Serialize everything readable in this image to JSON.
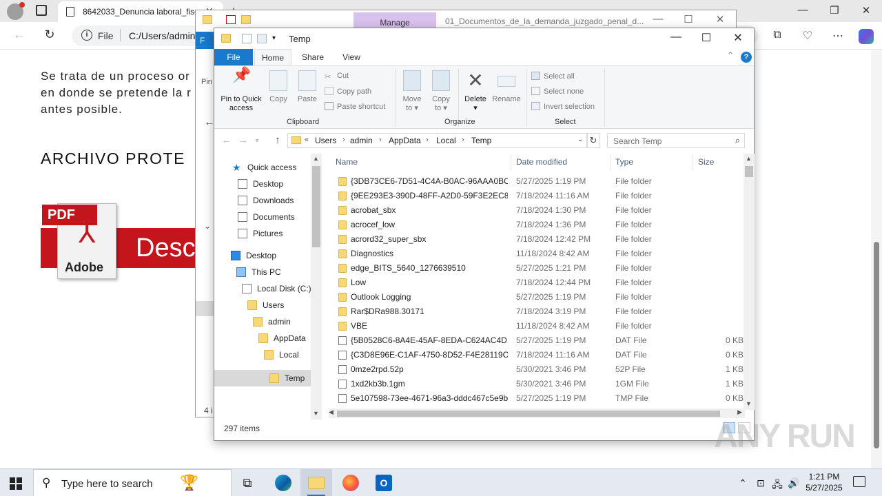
{
  "browser": {
    "tab_title": "8642033_Denuncia laboral_fiscal",
    "tab_close": "✕",
    "new_tab": "+",
    "address_scheme": "File",
    "address_url": "C:/Users/admin/",
    "win_min": "—",
    "win_max": "❐",
    "win_close": "✕"
  },
  "page": {
    "paragraph_lines": [
      "Se trata de un proceso or",
      "en donde se pretende la r",
      "antes posible."
    ],
    "heading": "ARCHIVO PROTE",
    "pdf_label": "PDF",
    "pdf_brand": "Adobe",
    "download_text": "Desc"
  },
  "back_window": {
    "manage_tab": "Manage",
    "title": "01_Documentos_de_la_demanda_juzgado_penal_d...",
    "menu_file": "F",
    "ribbon_label": "Pin",
    "status": "4 i"
  },
  "explorer": {
    "title": "Temp",
    "tabs": [
      "File",
      "Home",
      "Share",
      "View"
    ],
    "active_tab": "Home",
    "help": "?",
    "ribbon": {
      "clipboard": {
        "label": "Clipboard",
        "pin": [
          "Pin to Quick",
          "access"
        ],
        "copy": "Copy",
        "paste": "Paste",
        "cut": "Cut",
        "copy_path": "Copy path",
        "paste_shortcut": "Paste shortcut"
      },
      "organize": {
        "label": "Organize",
        "move_to": [
          "Move",
          "to ▾"
        ],
        "copy_to": [
          "Copy",
          "to ▾"
        ],
        "delete": [
          "Delete",
          "▾"
        ],
        "rename": "Rename"
      },
      "select": {
        "label": "Select",
        "select_all": "Select all",
        "select_none": "Select none",
        "invert": "Invert selection"
      }
    },
    "breadcrumb": [
      "Users",
      "admin",
      "AppData",
      "Local",
      "Temp"
    ],
    "breadcrumb_prefix": "«",
    "search_placeholder": "Search Temp",
    "nav_pane": [
      {
        "label": "Quick access",
        "icon": "star-icon"
      },
      {
        "label": "Desktop",
        "icon": "file-icon"
      },
      {
        "label": "Downloads",
        "icon": "file-icon"
      },
      {
        "label": "Documents",
        "icon": "file-icon"
      },
      {
        "label": "Pictures",
        "icon": "file-icon"
      },
      {
        "label": "Desktop",
        "icon": "desktop-icon"
      },
      {
        "label": "This PC",
        "icon": "pc-icon"
      },
      {
        "label": "Local Disk (C:)",
        "icon": "file-icon"
      },
      {
        "label": "Users",
        "icon": "folder-icon"
      },
      {
        "label": "admin",
        "icon": "folder-icon"
      },
      {
        "label": "AppData",
        "icon": "folder-icon"
      },
      {
        "label": "Local",
        "icon": "folder-icon"
      },
      {
        "label": "Temp",
        "icon": "folder-icon"
      }
    ],
    "columns": {
      "name": "Name",
      "date": "Date modified",
      "type": "Type",
      "size": "Size"
    },
    "files": [
      {
        "name": "{3DB73CE6-7D51-4C4A-B0AC-96AAA0BC...",
        "date": "5/27/2025 1:19 PM",
        "type": "File folder",
        "size": "",
        "icon": "folder-icon"
      },
      {
        "name": "{9EE293E3-390D-48FF-A2D0-59F3E2EC88...",
        "date": "7/18/2024 11:16 AM",
        "type": "File folder",
        "size": "",
        "icon": "folder-icon"
      },
      {
        "name": "acrobat_sbx",
        "date": "7/18/2024 1:30 PM",
        "type": "File folder",
        "size": "",
        "icon": "folder-icon"
      },
      {
        "name": "acrocef_low",
        "date": "7/18/2024 1:36 PM",
        "type": "File folder",
        "size": "",
        "icon": "folder-icon"
      },
      {
        "name": "acrord32_super_sbx",
        "date": "7/18/2024 12:42 PM",
        "type": "File folder",
        "size": "",
        "icon": "folder-icon"
      },
      {
        "name": "Diagnostics",
        "date": "11/18/2024 8:42 AM",
        "type": "File folder",
        "size": "",
        "icon": "folder-icon"
      },
      {
        "name": "edge_BITS_5640_1276639510",
        "date": "5/27/2025 1:21 PM",
        "type": "File folder",
        "size": "",
        "icon": "folder-icon"
      },
      {
        "name": "Low",
        "date": "7/18/2024 12:44 PM",
        "type": "File folder",
        "size": "",
        "icon": "folder-icon"
      },
      {
        "name": "Outlook Logging",
        "date": "5/27/2025 1:19 PM",
        "type": "File folder",
        "size": "",
        "icon": "folder-icon"
      },
      {
        "name": "Rar$DRa988.30171",
        "date": "7/18/2024 3:19 PM",
        "type": "File folder",
        "size": "",
        "icon": "folder-icon"
      },
      {
        "name": "VBE",
        "date": "11/18/2024 8:42 AM",
        "type": "File folder",
        "size": "",
        "icon": "folder-icon"
      },
      {
        "name": "{5B0528C6-8A4E-45AF-8EDA-C624AC4D...",
        "date": "5/27/2025 1:19 PM",
        "type": "DAT File",
        "size": "0 KB",
        "icon": "file-icon"
      },
      {
        "name": "{C3D8E96E-C1AF-4750-8D52-F4E28119C1...",
        "date": "7/18/2024 11:16 AM",
        "type": "DAT File",
        "size": "0 KB",
        "icon": "file-icon"
      },
      {
        "name": "0mze2rpd.52p",
        "date": "5/30/2021 3:46 PM",
        "type": "52P File",
        "size": "1 KB",
        "icon": "file-icon"
      },
      {
        "name": "1xd2kb3b.1gm",
        "date": "5/30/2021 3:46 PM",
        "type": "1GM File",
        "size": "1 KB",
        "icon": "file-icon"
      },
      {
        "name": "5e107598-73ee-4671-96a3-dddc467c5e9b...",
        "date": "5/27/2025 1:19 PM",
        "type": "TMP File",
        "size": "0 KB",
        "icon": "file-icon"
      }
    ],
    "status": "297 items"
  },
  "watermark": "ANY RUN",
  "taskbar": {
    "search_placeholder": "Type here to search",
    "apps": [
      "task-view",
      "edge",
      "file-explorer",
      "firefox",
      "outlook"
    ],
    "active_app": "file-explorer",
    "time": "1:21 PM",
    "date": "5/27/2025"
  },
  "colors": {
    "accent": "#1979ca",
    "manage_tab": "#d9c1ee",
    "folder": "#f8d775",
    "pdf_red": "#c4151c"
  }
}
